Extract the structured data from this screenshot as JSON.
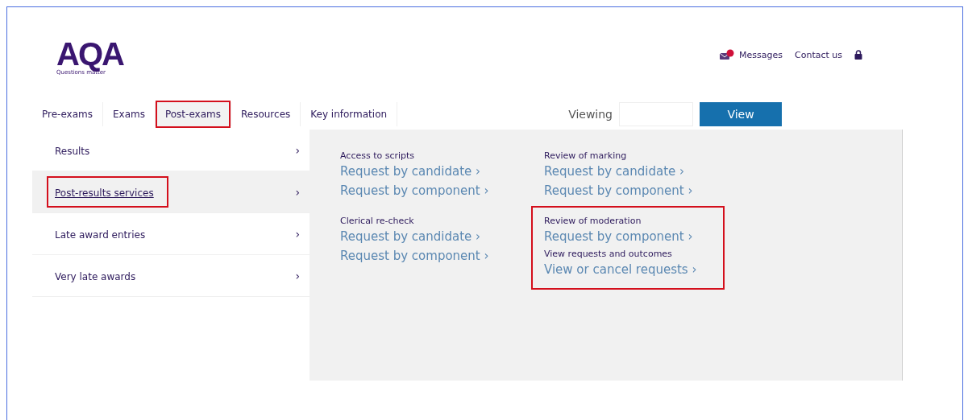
{
  "logo": {
    "text": "AQA",
    "tagline": "Questions matter"
  },
  "utility_links": [
    {
      "kind": "messages",
      "label": "Messages"
    },
    {
      "kind": "plain",
      "label": "Contact us"
    },
    {
      "kind": "lock"
    }
  ],
  "nav_tabs": [
    {
      "label": "Pre-exams",
      "selected": false,
      "highlighted": false
    },
    {
      "label": "Exams",
      "selected": false,
      "highlighted": false
    },
    {
      "label": "Post-exams",
      "selected": true,
      "highlighted": true
    },
    {
      "label": "Resources",
      "selected": false,
      "highlighted": false
    },
    {
      "label": "Key information",
      "selected": false,
      "highlighted": false
    }
  ],
  "viewing": {
    "label": "Viewing",
    "button": "View"
  },
  "sidebar": [
    {
      "label": "Results",
      "chevron": "›",
      "selected": false,
      "highlighted": false
    },
    {
      "label": "Post-results services",
      "chevron": "›",
      "selected": true,
      "highlighted": true
    },
    {
      "label": "Late award entries",
      "chevron": "›",
      "selected": false,
      "highlighted": false
    },
    {
      "label": "Very late awards",
      "chevron": "›",
      "selected": false,
      "highlighted": false
    }
  ],
  "columns": [
    {
      "blocks": [
        {
          "highlighted": false,
          "sections": [
            {
              "heading": "Access to scripts",
              "links": [
                "Request by candidate",
                "Request by component"
              ]
            }
          ]
        },
        {
          "highlighted": false,
          "sections": [
            {
              "heading": "Clerical re-check",
              "links": [
                "Request by candidate",
                "Request by component"
              ]
            }
          ]
        }
      ]
    },
    {
      "blocks": [
        {
          "highlighted": false,
          "sections": [
            {
              "heading": "Review of marking",
              "links": [
                "Request by candidate",
                "Request by component"
              ]
            }
          ]
        },
        {
          "highlighted": true,
          "sections": [
            {
              "heading": "Review of moderation",
              "links": [
                "Request by component"
              ]
            },
            {
              "heading": "View requests and outcomes",
              "links": [
                "View or cancel requests"
              ]
            }
          ]
        }
      ]
    }
  ],
  "link_chevron": "›"
}
